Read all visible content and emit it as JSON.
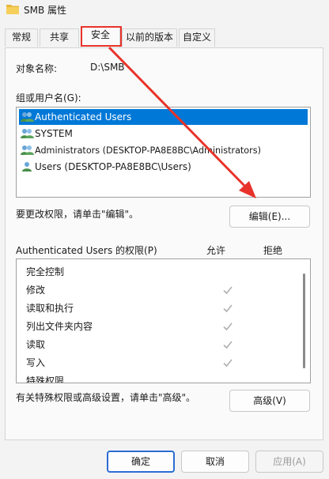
{
  "window": {
    "title": "SMB 属性"
  },
  "tabs": [
    {
      "label": "常规"
    },
    {
      "label": "共享"
    },
    {
      "label": "安全"
    },
    {
      "label": "以前的版本"
    },
    {
      "label": "自定义"
    }
  ],
  "security": {
    "object_label": "对象名称:",
    "object_value": "D:\\SMB",
    "groups_label": "组或用户名(G):",
    "groups": [
      {
        "label": "Authenticated Users",
        "selected": true
      },
      {
        "label": "SYSTEM",
        "selected": false
      },
      {
        "label": "Administrators (DESKTOP-PA8E8BC\\Administrators)",
        "selected": false
      },
      {
        "label": "Users (DESKTOP-PA8E8BC\\Users)",
        "selected": false
      }
    ],
    "edit_hint": "要更改权限，请单击\"编辑\"。",
    "edit_button": "编辑(E)...",
    "perm_title": "Authenticated Users 的权限(P)",
    "col_allow": "允许",
    "col_deny": "拒绝",
    "permissions": [
      {
        "label": "完全控制",
        "allow": false
      },
      {
        "label": "修改",
        "allow": true
      },
      {
        "label": "读取和执行",
        "allow": true
      },
      {
        "label": "列出文件夹内容",
        "allow": true
      },
      {
        "label": "读取",
        "allow": true
      },
      {
        "label": "写入",
        "allow": true
      },
      {
        "label": "特殊权限",
        "allow": false
      }
    ],
    "advanced_hint": "有关特殊权限或高级设置，请单击\"高级\"。",
    "advanced_button": "高级(V)"
  },
  "footer": {
    "ok": "确定",
    "cancel": "取消",
    "apply": "应用(A)"
  },
  "colors": {
    "accent": "#0078d7",
    "annotation": "#e8332a"
  }
}
